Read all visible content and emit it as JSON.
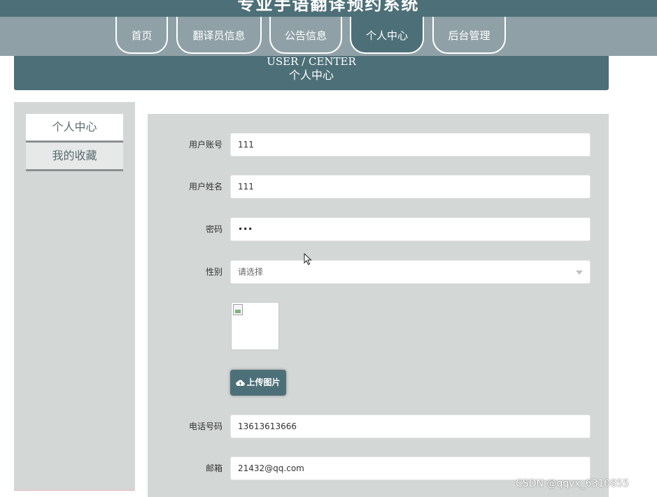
{
  "site": {
    "title": "专业手语翻译预约系统"
  },
  "nav": {
    "items": [
      {
        "label": "首页"
      },
      {
        "label": "翻译员信息"
      },
      {
        "label": "公告信息"
      },
      {
        "label": "个人中心"
      },
      {
        "label": "后台管理"
      }
    ],
    "active": "个人中心"
  },
  "banner": {
    "en": "USER / CENTER",
    "cn": "个人中心"
  },
  "sidebar": {
    "items": [
      {
        "label": "个人中心"
      },
      {
        "label": "我的收藏"
      }
    ]
  },
  "form": {
    "account": {
      "label": "用户账号",
      "value": "111"
    },
    "name": {
      "label": "用户姓名",
      "value": "111"
    },
    "password": {
      "label": "密码",
      "value": "•••"
    },
    "gender": {
      "label": "性别",
      "placeholder": "请选择"
    },
    "upload_label": "上传图片",
    "phone": {
      "label": "电话号码",
      "value": "13613613666"
    },
    "email": {
      "label": "邮箱",
      "value": "21432@qq.com"
    }
  },
  "watermark": "CSDN @qqvx_6310855",
  "colors": {
    "primary": "#4d6f78",
    "nav_band": "#8fa1a6",
    "panel": "#d3d7d6"
  }
}
